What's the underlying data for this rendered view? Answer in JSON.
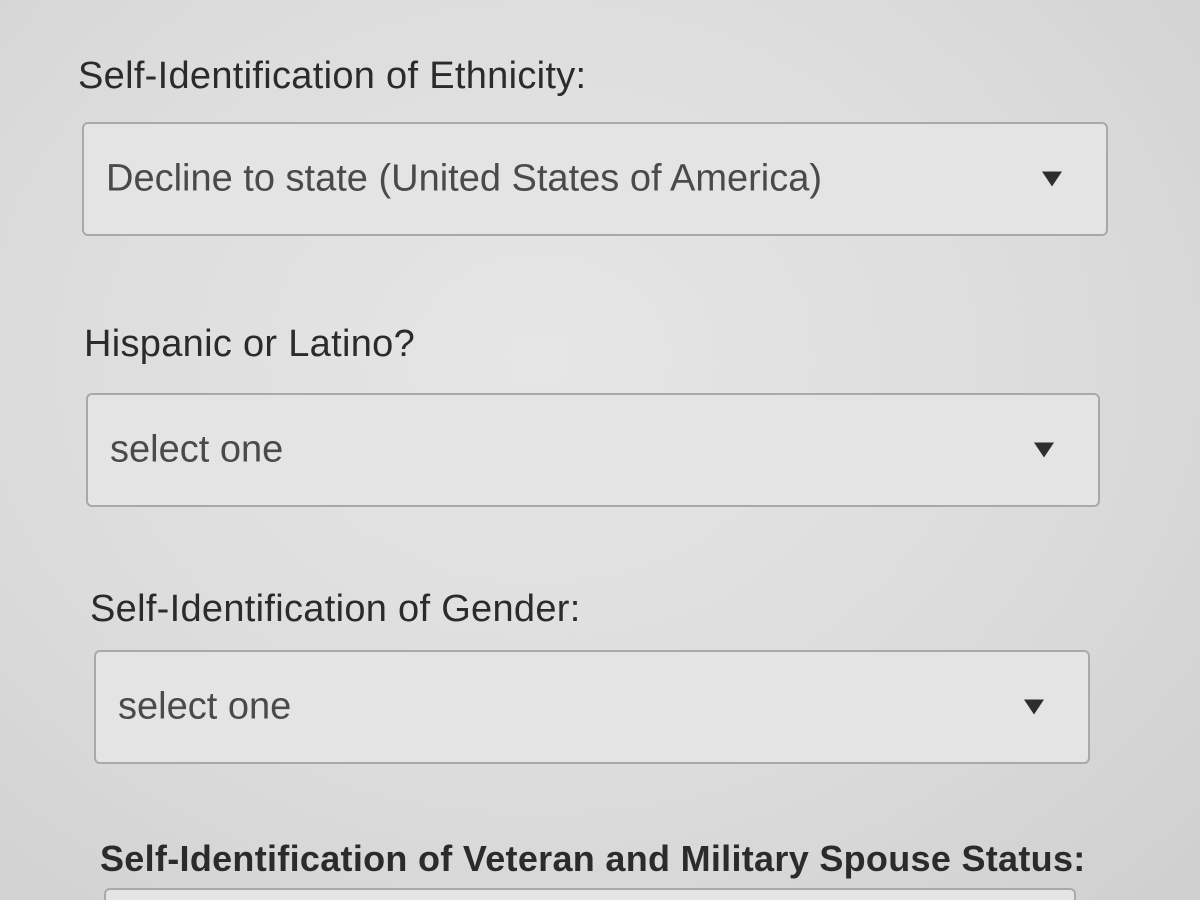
{
  "form": {
    "ethnicity": {
      "label": "Self-Identification of Ethnicity:",
      "selected_value": "Decline to state (United States of America)",
      "arrow_icon": "dropdown-arrow-icon"
    },
    "hispanic": {
      "label": "Hispanic or Latino?",
      "selected_value": "select one",
      "arrow_icon": "dropdown-arrow-icon"
    },
    "gender": {
      "label": "Self-Identification of Gender:",
      "selected_value": "select one",
      "arrow_icon": "dropdown-arrow-icon"
    },
    "veteran": {
      "label": "Self-Identification of Veteran and Military Spouse Status:"
    }
  },
  "colors": {
    "background": "#dcdcdc",
    "select_background": "#e4e4e4",
    "select_border": "#a9a9a9",
    "text": "#2b2b2b",
    "placeholder_text": "#4a4a4a"
  }
}
